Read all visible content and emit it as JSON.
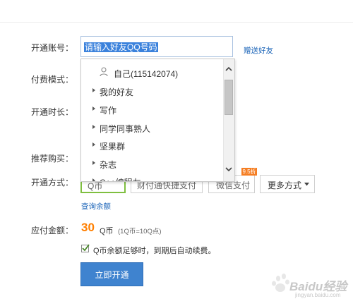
{
  "form": {
    "account_label": "开通账号：",
    "account_value": "请输入好友QQ号码",
    "gift_link": "赠送好友",
    "pay_mode_label": "付费模式：",
    "duration_label": "开通时长：",
    "recommend_label": "推荐购买：",
    "method_label": "开通方式：",
    "methods": [
      "Q币",
      "财付通快捷支付",
      "微信支付",
      "更多方式"
    ],
    "sale_badge": "9.5折",
    "balance_link": "查询余额",
    "amount_label": "应付金额：",
    "amount_value": "30",
    "amount_unit": "Q币",
    "amount_note": "(1Q币=10Q点)",
    "auto_renew": "Q币余额足够时，到期后自动续费。",
    "auto_renew_checked": true,
    "submit_label": "立即开通"
  },
  "dropdown": {
    "items": [
      {
        "label": "自己(115142074)",
        "icon": "person-icon"
      },
      {
        "label": "我的好友",
        "icon": "expand-triangle-icon"
      },
      {
        "label": "写作",
        "icon": "expand-triangle-icon"
      },
      {
        "label": "同学同事熟人",
        "icon": "expand-triangle-icon"
      },
      {
        "label": "坚果群",
        "icon": "expand-triangle-icon"
      },
      {
        "label": "杂志",
        "icon": "expand-triangle-icon"
      },
      {
        "label": "C++编程友",
        "icon": "expand-triangle-icon"
      }
    ]
  },
  "watermark": {
    "brand": "Baidu经验",
    "sub": "jingyan.baidu.com"
  },
  "colors": {
    "link": "#1b64b8",
    "primary_button": "#3f83cf",
    "amount": "#ff7f00",
    "selected_border": "#7fbf40",
    "sale_badge": "#f57e23"
  }
}
